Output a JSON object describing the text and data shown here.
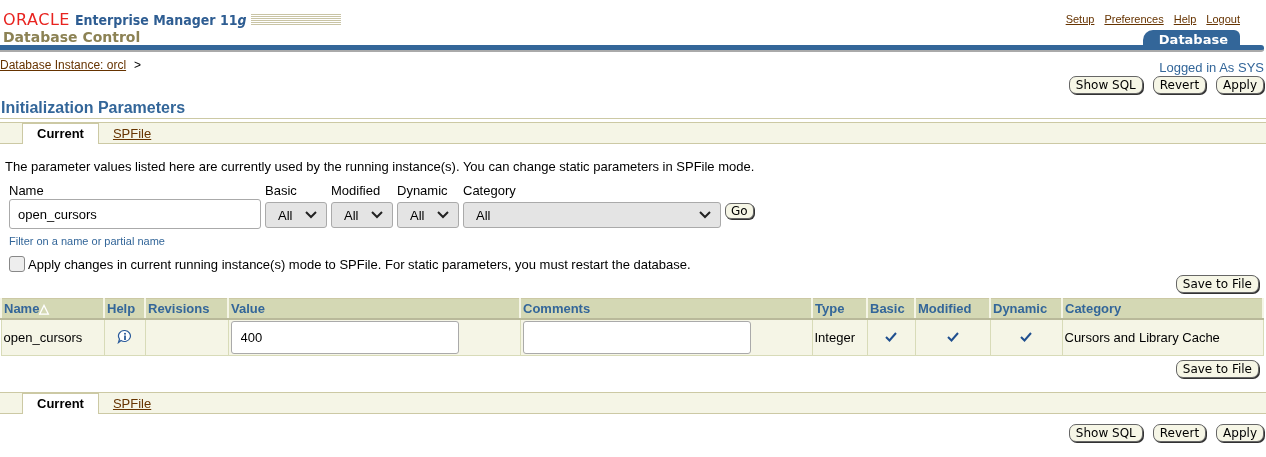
{
  "header": {
    "brand": "ORACLE",
    "product": "Enterprise Manager 11",
    "product_suffix": "g",
    "subtitle": "Database Control",
    "global_links": [
      "Setup",
      "Preferences",
      "Help",
      "Logout"
    ],
    "area_tab": "Database"
  },
  "breadcrumb": {
    "link": "Database Instance: orcl",
    "separator": ">"
  },
  "login": "Logged in As SYS",
  "top_buttons": [
    "Show SQL",
    "Revert",
    "Apply"
  ],
  "page_title": "Initialization Parameters",
  "tabs": [
    {
      "label": "Current",
      "selected": true
    },
    {
      "label": "SPFile",
      "selected": false
    }
  ],
  "description": "The parameter values listed here are currently used by the running instance(s). You can change static parameters in SPFile mode.",
  "filters": {
    "name": {
      "label": "Name",
      "value": "open_cursors",
      "hint": "Filter on a name or partial name"
    },
    "selects": [
      {
        "label": "Basic",
        "value": "All",
        "wide": false
      },
      {
        "label": "Modified",
        "value": "All",
        "wide": false
      },
      {
        "label": "Dynamic",
        "value": "All",
        "wide": false
      },
      {
        "label": "Category",
        "value": "All",
        "wide": true
      }
    ],
    "go": "Go"
  },
  "apply_spfile": {
    "label": "Apply changes in current running instance(s) mode to SPFile. For static parameters, you must restart the database.",
    "checked": false
  },
  "save_button": "Save to File",
  "table": {
    "columns": [
      "Name",
      "Help",
      "Revisions",
      "Value",
      "Comments",
      "Type",
      "Basic",
      "Modified",
      "Dynamic",
      "Category"
    ],
    "sort_mark": "△",
    "rows": [
      {
        "name": "open_cursors",
        "value": "400",
        "comments": "",
        "type": "Integer",
        "basic": true,
        "modified": true,
        "dynamic": true,
        "category": "Cursors and Library Cache"
      }
    ]
  },
  "bottom_save_button": "Save to File",
  "bottom_tabs": [
    {
      "label": "Current",
      "selected": true
    },
    {
      "label": "SPFile",
      "selected": false
    }
  ],
  "bottom_buttons": [
    "Show SQL",
    "Revert",
    "Apply"
  ]
}
